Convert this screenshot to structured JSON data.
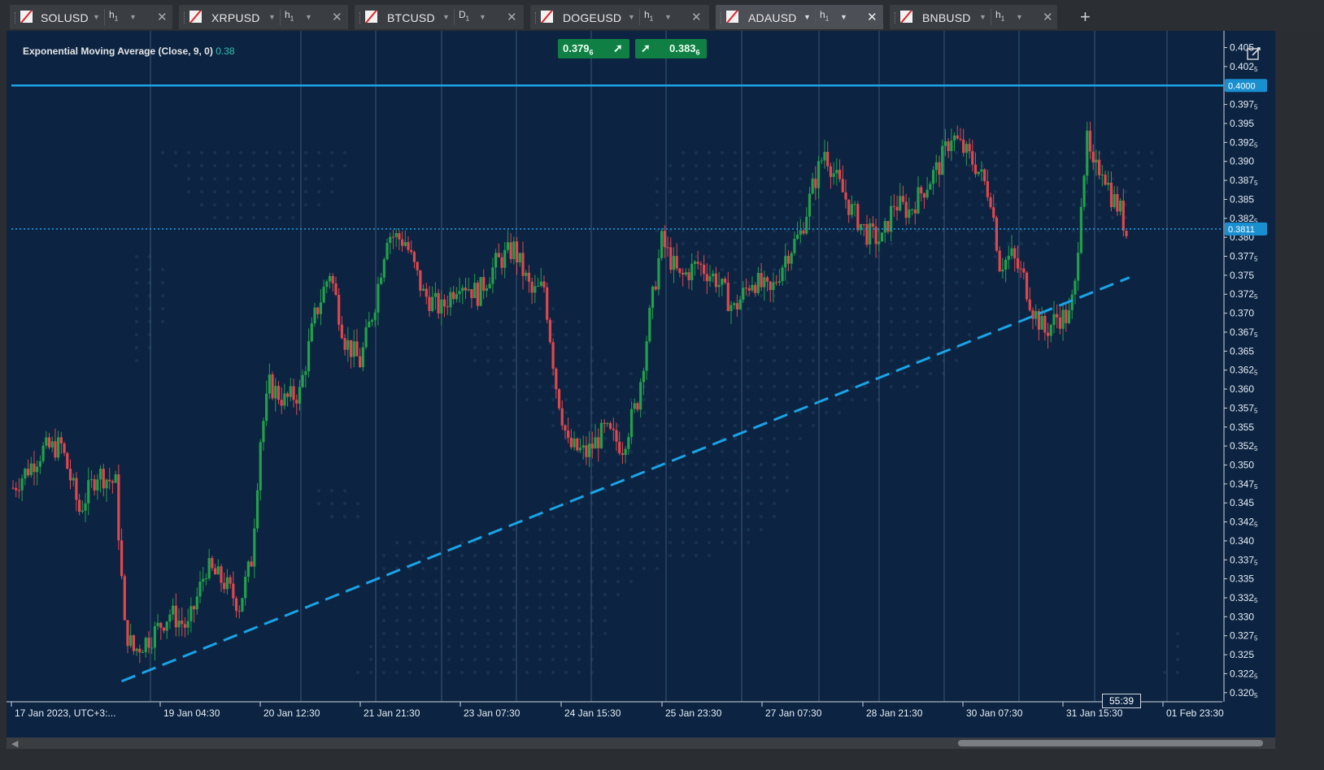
{
  "tabs": [
    {
      "symbol": "SOLUSD",
      "timeframe": "h",
      "timeframe_sub": "1",
      "active": false
    },
    {
      "symbol": "XRPUSD",
      "timeframe": "h",
      "timeframe_sub": "1",
      "active": false
    },
    {
      "symbol": "BTCUSD",
      "timeframe": "D",
      "timeframe_sub": "1",
      "active": false
    },
    {
      "symbol": "DOGEUSD",
      "timeframe": "h",
      "timeframe_sub": "1",
      "active": false
    },
    {
      "symbol": "ADAUSD",
      "timeframe": "h",
      "timeframe_sub": "1",
      "active": true
    },
    {
      "symbol": "BNBUSD",
      "timeframe": "h",
      "timeframe_sub": "1",
      "active": false
    }
  ],
  "add_tab": "+",
  "indicator": {
    "label": "Exponential Moving Average (Close, 9, 0)",
    "value": "0.38"
  },
  "sell_button": {
    "price": "0.379",
    "pip": "6"
  },
  "buy_button": {
    "price": "0.383",
    "pip": "6"
  },
  "timer": "55:39",
  "colors": {
    "background": "#0c2442",
    "up": "#22a04a",
    "down": "#e0474c",
    "line": "#1aa3e6",
    "label_bg": "#1a8fd0"
  },
  "chart_data": {
    "type": "candlestick",
    "symbol": "ADAUSD",
    "interval": "1 hour",
    "y_range": [
      0.3188,
      0.4072
    ],
    "y_ticks": [
      "0.320",
      "0.322",
      "0.325",
      "0.327",
      "0.330",
      "0.332",
      "0.335",
      "0.337",
      "0.340",
      "0.342",
      "0.345",
      "0.347",
      "0.350",
      "0.352",
      "0.355",
      "0.357",
      "0.360",
      "0.362",
      "0.365",
      "0.367",
      "0.370",
      "0.372",
      "0.375",
      "0.377",
      "0.380",
      "0.382",
      "0.385",
      "0.387",
      "0.390",
      "0.392",
      "0.395",
      "0.397",
      "0.402",
      "0.405",
      "0.40"
    ],
    "y_tick_subs": [
      "5",
      "5",
      "",
      "5",
      "",
      "5",
      "",
      "5",
      "",
      "5",
      "",
      "5",
      "",
      "5",
      "",
      "5",
      "",
      "5",
      "",
      "5",
      "",
      "5",
      "",
      "5",
      "",
      "5",
      "",
      "5",
      "",
      "5",
      "",
      "5",
      "5",
      "",
      ""
    ],
    "x_labels": [
      "17 Jan 2023, UTC+3:...",
      "19 Jan 04:30",
      "20 Jan 12:30",
      "21 Jan 21:30",
      "23 Jan 07:30",
      "24 Jan 15:30",
      "25 Jan 23:30",
      "27 Jan 07:30",
      "28 Jan 21:30",
      "30 Jan 07:30",
      "31 Jan 15:30",
      "01 Feb 23:30"
    ],
    "horizontal_line": {
      "value": 0.4,
      "label": "0.4000"
    },
    "current_price": {
      "value": 0.3811,
      "label": "0.3811"
    },
    "trendline": {
      "from": [
        "19 Jan 00:00",
        0.3215
      ],
      "to": [
        "01 Feb 22:00",
        0.3747
      ]
    },
    "close_path": [
      [
        "17 Jan 12:00",
        0.347
      ],
      [
        "17 Jan 22:00",
        0.352
      ],
      [
        "18 Jan 04:00",
        0.3525
      ],
      [
        "18 Jan 10:00",
        0.344
      ],
      [
        "18 Jan 16:00",
        0.349
      ],
      [
        "18 Jan 22:00",
        0.3475
      ],
      [
        "19 Jan 01:00",
        0.3285
      ],
      [
        "19 Jan 04:00",
        0.3255
      ],
      [
        "19 Jan 10:00",
        0.3275
      ],
      [
        "19 Jan 16:00",
        0.3305
      ],
      [
        "19 Jan 22:00",
        0.3285
      ],
      [
        "20 Jan 04:00",
        0.3365
      ],
      [
        "20 Jan 10:00",
        0.3345
      ],
      [
        "20 Jan 15:00",
        0.3315
      ],
      [
        "20 Jan 19:00",
        0.3375
      ],
      [
        "20 Jan 22:00",
        0.3535
      ],
      [
        "21 Jan 01:00",
        0.3605
      ],
      [
        "21 Jan 06:00",
        0.3585
      ],
      [
        "21 Jan 11:00",
        0.3595
      ],
      [
        "21 Jan 16:00",
        0.3695
      ],
      [
        "21 Jan 21:00",
        0.3755
      ],
      [
        "22 Jan 02:00",
        0.3665
      ],
      [
        "22 Jan 07:00",
        0.3635
      ],
      [
        "22 Jan 12:00",
        0.3715
      ],
      [
        "22 Jan 16:00",
        0.3805
      ],
      [
        "22 Jan 22:00",
        0.3795
      ],
      [
        "23 Jan 04:00",
        0.3725
      ],
      [
        "23 Jan 10:00",
        0.3705
      ],
      [
        "23 Jan 16:00",
        0.3745
      ],
      [
        "23 Jan 22:00",
        0.3725
      ],
      [
        "24 Jan 04:00",
        0.3765
      ],
      [
        "24 Jan 10:00",
        0.3785
      ],
      [
        "24 Jan 16:00",
        0.3725
      ],
      [
        "24 Jan 20:00",
        0.3735
      ],
      [
        "25 Jan 00:00",
        0.3605
      ],
      [
        "25 Jan 04:00",
        0.3525
      ],
      [
        "25 Jan 10:00",
        0.3515
      ],
      [
        "25 Jan 16:00",
        0.3545
      ],
      [
        "25 Jan 22:00",
        0.3525
      ],
      [
        "26 Jan 03:00",
        0.3585
      ],
      [
        "26 Jan 07:00",
        0.3695
      ],
      [
        "26 Jan 11:00",
        0.3795
      ],
      [
        "26 Jan 17:00",
        0.3745
      ],
      [
        "26 Jan 23:00",
        0.3765
      ],
      [
        "27 Jan 05:00",
        0.3745
      ],
      [
        "27 Jan 11:00",
        0.3705
      ],
      [
        "27 Jan 17:00",
        0.3745
      ],
      [
        "27 Jan 23:00",
        0.3725
      ],
      [
        "28 Jan 04:00",
        0.3775
      ],
      [
        "28 Jan 09:00",
        0.3805
      ],
      [
        "28 Jan 13:00",
        0.3865
      ],
      [
        "28 Jan 17:00",
        0.3915
      ],
      [
        "28 Jan 21:00",
        0.3875
      ],
      [
        "29 Jan 02:00",
        0.3835
      ],
      [
        "29 Jan 07:00",
        0.3805
      ],
      [
        "29 Jan 12:00",
        0.3795
      ],
      [
        "29 Jan 16:00",
        0.3845
      ],
      [
        "29 Jan 21:00",
        0.3835
      ],
      [
        "30 Jan 02:00",
        0.3865
      ],
      [
        "30 Jan 07:00",
        0.3895
      ],
      [
        "30 Jan 11:00",
        0.3935
      ],
      [
        "30 Jan 15:00",
        0.3915
      ],
      [
        "30 Jan 19:00",
        0.3895
      ],
      [
        "31 Jan 00:00",
        0.3855
      ],
      [
        "31 Jan 03:00",
        0.3765
      ],
      [
        "31 Jan 07:00",
        0.3775
      ],
      [
        "31 Jan 11:00",
        0.3745
      ],
      [
        "31 Jan 14:00",
        0.3705
      ],
      [
        "31 Jan 18:00",
        0.3675
      ],
      [
        "31 Jan 22:00",
        0.3695
      ],
      [
        "01 Feb 02:00",
        0.3695
      ],
      [
        "01 Feb 04:00",
        0.3735
      ],
      [
        "01 Feb 06:00",
        0.3855
      ],
      [
        "01 Feb 08:00",
        0.3925
      ],
      [
        "01 Feb 10:00",
        0.3885
      ],
      [
        "01 Feb 13:00",
        0.3895
      ],
      [
        "01 Feb 16:00",
        0.3855
      ],
      [
        "01 Feb 19:00",
        0.3835
      ],
      [
        "01 Feb 21:00",
        0.3805
      ]
    ],
    "grid": true,
    "legend": "none"
  }
}
